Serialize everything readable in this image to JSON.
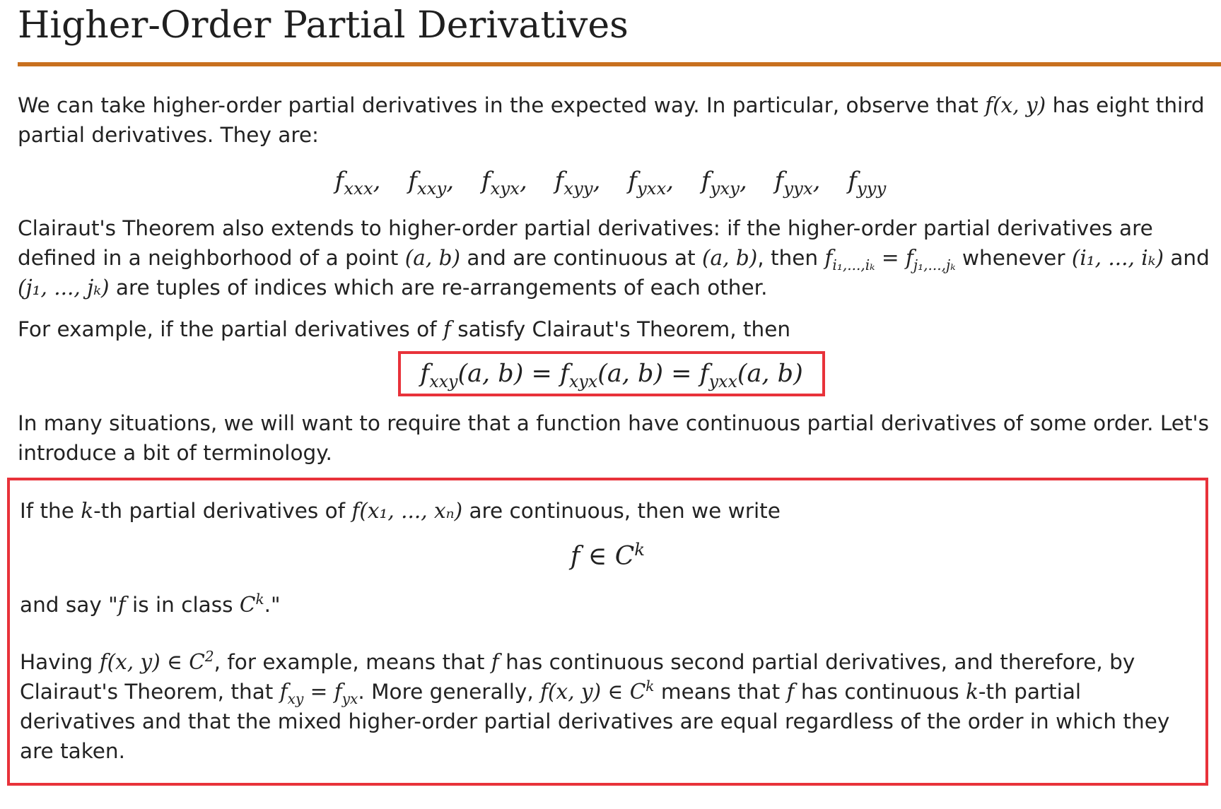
{
  "title": "Higher-Order Partial Derivatives",
  "colors": {
    "rule": "#c8701e",
    "highlight_border": "#e8323a"
  },
  "p1": {
    "a": "We can take higher-order partial derivatives in the expected way. In particular, observe that ",
    "math": "f(x, y)",
    "b": " has eight third partial derivatives. They are:"
  },
  "third_derivatives": [
    {
      "f": "f",
      "sub": "xxx"
    },
    {
      "f": "f",
      "sub": "xxy"
    },
    {
      "f": "f",
      "sub": "xyx"
    },
    {
      "f": "f",
      "sub": "xyy"
    },
    {
      "f": "f",
      "sub": "yxx"
    },
    {
      "f": "f",
      "sub": "yxy"
    },
    {
      "f": "f",
      "sub": "yyx"
    },
    {
      "f": "f",
      "sub": "yyy"
    }
  ],
  "p2": {
    "a": "Clairaut's Theorem also extends to higher-order partial derivatives: if the higher-order partial derivatives are defined in a neighborhood of a point ",
    "pt1": "(a, b)",
    "b": " and are continuous at ",
    "pt2": "(a, b)",
    "c": ", then ",
    "eq_lhs_sub": "i₁,...,iₖ",
    "eq_rhs_sub": "j₁,...,jₖ",
    "d": " whenever ",
    "tuple1": "(i₁, ..., iₖ)",
    "e": " and ",
    "tuple2": "(j₁, ..., jₖ)",
    "f": " are tuples of indices which are re-arrangements of each other."
  },
  "p3": {
    "a": "For example, if the partial derivatives of ",
    "f": "f",
    "b": " satisfy Clairaut's Theorem, then"
  },
  "equality": {
    "s1": "xxy",
    "s2": "xyx",
    "s3": "yxx",
    "args": "(a, b)"
  },
  "p4": "In many situations, we will want to require that a function have continuous partial derivatives of some order. Let's introduce a bit of terminology.",
  "definition": {
    "a": "If the ",
    "k": "k",
    "b": "-th partial derivatives of ",
    "func": "f(x₁, ..., xₙ)",
    "c": " are continuous, then we write",
    "display": "f ∈ C",
    "display_sup": "k",
    "say_a": "and say \"",
    "say_f": "f",
    "say_b": " is in class ",
    "say_c": "C",
    "say_sup": "k",
    "say_d": ".\"",
    "h_a": "Having ",
    "h_m1": "f(x, y) ∈ C",
    "h_m1_sup": "2",
    "h_b": ", for example, means that ",
    "h_f": "f",
    "h_c": " has continuous second partial derivatives, and therefore, by Clairaut's Theorem, that ",
    "h_fxy": "xy",
    "h_fyx": "yx",
    "h_d": ". More generally, ",
    "h_m2": "f(x, y) ∈ C",
    "h_m2_sup": "k",
    "h_e": " means that ",
    "h_f2": "f",
    "h_g": " has continuous ",
    "h_k": "k",
    "h_h": "-th partial derivatives and that the mixed higher-order partial derivatives are equal regardless of the order in which they are taken."
  }
}
